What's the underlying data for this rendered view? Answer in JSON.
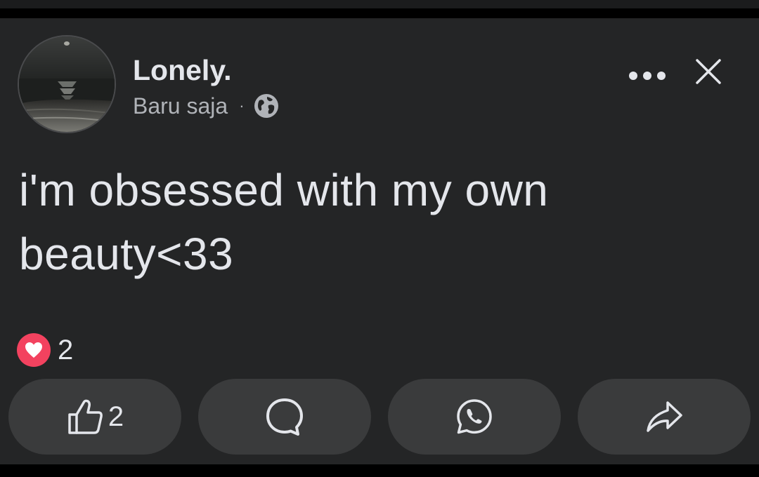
{
  "post": {
    "author": "Lonely.",
    "timestamp": "Baru saja",
    "separator": "·",
    "audience_icon": "globe-icon",
    "text": "i'm obsessed with my own beauty<33",
    "header_actions": {
      "more_icon": "more-dots-icon",
      "close_icon": "close-icon"
    }
  },
  "reactions": {
    "icon": "heart-love-icon",
    "count": "2"
  },
  "actions": {
    "like": {
      "icon": "thumbs-up-icon",
      "count": "2"
    },
    "comment": {
      "icon": "comment-bubble-icon"
    },
    "whatsapp": {
      "icon": "whatsapp-icon"
    },
    "share": {
      "icon": "share-arrow-icon"
    }
  },
  "colors": {
    "background": "#242526",
    "button_bg": "#3a3b3c",
    "primary_text": "#e4e6eb",
    "secondary_text": "#b0b3b8",
    "love_red": "#f3425f"
  }
}
